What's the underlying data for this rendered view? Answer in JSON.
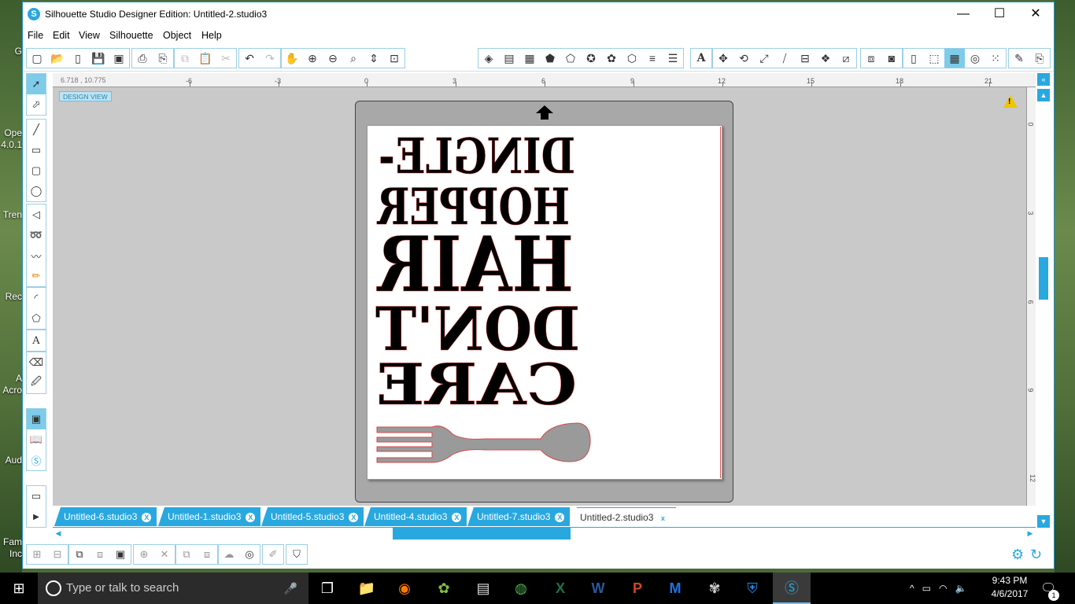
{
  "desktop": {
    "icons": [
      {
        "label": "G"
      },
      {
        "label": "Ope"
      },
      {
        "label": "4.0.1"
      },
      {
        "label": "Tren"
      },
      {
        "label": "Rec"
      },
      {
        "label": "A"
      },
      {
        "label": "Acro"
      },
      {
        "label": "Aud"
      },
      {
        "label": "Fam"
      },
      {
        "label": "Inc"
      }
    ]
  },
  "window": {
    "title": "Silhouette Studio Designer Edition: Untitled-2.studio3",
    "app_icon_letter": "S",
    "controls": {
      "minimize": "—",
      "maximize": "☐",
      "close": "✕"
    }
  },
  "menu": {
    "items": [
      "File",
      "Edit",
      "View",
      "Silhouette",
      "Object",
      "Help"
    ]
  },
  "canvas": {
    "coordinates": "6.718 , 10.775",
    "design_view_label": "DESIGN VIEW",
    "ruler_top_ticks": [
      "-6",
      "-3",
      "0",
      "3",
      "6",
      "9",
      "12",
      "15",
      "18",
      "21"
    ],
    "ruler_right_ticks": [
      "0",
      "3",
      "6",
      "9",
      "12"
    ],
    "warning_symbol": "!",
    "design_lines": [
      "DINGLE-",
      "HOPPER",
      "HAIR",
      "DON'T",
      "CARE"
    ]
  },
  "tabs": [
    {
      "label": "Untitled-6.studio3",
      "close": "X",
      "active": false
    },
    {
      "label": "Untitled-1.studio3",
      "close": "X",
      "active": false
    },
    {
      "label": "Untitled-5.studio3",
      "close": "X",
      "active": false
    },
    {
      "label": "Untitled-4.studio3",
      "close": "X",
      "active": false
    },
    {
      "label": "Untitled-7.studio3",
      "close": "X",
      "active": false
    },
    {
      "label": "Untitled-2.studio3",
      "close": "x",
      "active": true
    }
  ],
  "taskbar": {
    "search_placeholder": "Type or talk to search",
    "time": "9:43 PM",
    "date": "4/6/2017",
    "notification_count": "1"
  },
  "colors": {
    "accent": "#29a8e0",
    "mat": "#a8a8a8",
    "canvas_bg": "#c9c9c9",
    "cut_line": "#d95555"
  }
}
